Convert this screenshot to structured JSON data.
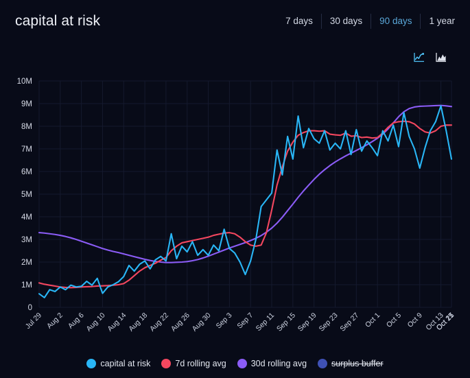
{
  "header": {
    "title": "capital at risk",
    "ranges": [
      {
        "label": "7 days",
        "active": false
      },
      {
        "label": "30 days",
        "active": false
      },
      {
        "label": "90 days",
        "active": true
      },
      {
        "label": "1 year",
        "active": false
      }
    ],
    "chart_type_buttons": [
      {
        "name": "line-chart-icon",
        "active": true
      },
      {
        "name": "area-chart-icon",
        "active": false
      }
    ]
  },
  "colors": {
    "background": "#080b18",
    "capital_at_risk": "#29b6f6",
    "rolling_7d": "#f4475f",
    "rolling_30d": "#8b5cf6",
    "surplus_buffer": "#3f51b5",
    "grid": "#151a2e",
    "accent": "#5aa7d8",
    "text": "#e8eaf2"
  },
  "legend": [
    {
      "label": "capital at risk",
      "color": "#29b6f6",
      "enabled": true
    },
    {
      "label": "7d rolling avg",
      "color": "#f4475f",
      "enabled": true
    },
    {
      "label": "30d rolling avg",
      "color": "#8b5cf6",
      "enabled": true
    },
    {
      "label": "surplus buffer",
      "color": "#3f51b5",
      "enabled": false
    }
  ],
  "chart_data": {
    "type": "line",
    "title": "capital at risk",
    "xlabel": "",
    "ylabel": "",
    "ylim": [
      0,
      10000000
    ],
    "yticks": [
      0,
      1000000,
      2000000,
      3000000,
      4000000,
      5000000,
      6000000,
      7000000,
      8000000,
      9000000,
      10000000
    ],
    "ytick_labels": [
      "0",
      "1M",
      "2M",
      "3M",
      "4M",
      "5M",
      "6M",
      "7M",
      "8M",
      "9M",
      "10M"
    ],
    "grid": true,
    "legend_position": "bottom",
    "x_tick_labels": [
      "Jul 29",
      "Aug 2",
      "Aug 6",
      "Aug 10",
      "Aug 14",
      "Aug 18",
      "Aug 22",
      "Aug 26",
      "Aug 30",
      "Sep 3",
      "Sep 7",
      "Sep 11",
      "Sep 15",
      "Sep 19",
      "Sep 23",
      "Sep 27",
      "Oct 1",
      "Oct 5",
      "Oct 9",
      "Oct 13",
      "Oct 17",
      "Oct 21",
      "Oct 25"
    ],
    "x_tick_step_days": 4,
    "x_start": "Jul 29",
    "x_end": "Oct 27",
    "series": [
      {
        "name": "capital at risk",
        "color": "#29b6f6",
        "visible": true,
        "values": [
          600000,
          430000,
          780000,
          700000,
          900000,
          780000,
          980000,
          900000,
          930000,
          1150000,
          980000,
          1280000,
          620000,
          900000,
          1000000,
          1130000,
          1360000,
          1850000,
          1600000,
          1900000,
          2050000,
          1700000,
          2100000,
          2250000,
          2050000,
          3250000,
          2150000,
          2700000,
          2450000,
          2900000,
          2300000,
          2550000,
          2300000,
          2750000,
          2500000,
          3450000,
          2600000,
          2400000,
          2000000,
          1450000,
          2050000,
          3000000,
          4450000,
          4750000,
          5050000,
          6950000,
          5850000,
          7550000,
          6550000,
          8450000,
          7050000,
          7900000,
          7450000,
          7250000,
          7800000,
          6950000,
          7250000,
          7000000,
          7800000,
          6750000,
          7850000,
          6900000,
          7350000,
          7050000,
          6700000,
          7800000,
          7350000,
          8050000,
          7100000,
          8600000,
          7550000,
          7000000,
          6150000,
          7050000,
          7800000,
          8200000,
          8900000,
          7800000,
          6550000
        ]
      },
      {
        "name": "7d rolling avg",
        "color": "#f4475f",
        "visible": true,
        "values": [
          1080000,
          1020000,
          980000,
          940000,
          900000,
          880000,
          870000,
          880000,
          900000,
          910000,
          920000,
          940000,
          950000,
          960000,
          980000,
          1000000,
          1050000,
          1200000,
          1400000,
          1600000,
          1750000,
          1850000,
          1950000,
          2080000,
          2200000,
          2500000,
          2700000,
          2850000,
          2900000,
          2950000,
          3000000,
          3050000,
          3100000,
          3180000,
          3230000,
          3280000,
          3300000,
          3250000,
          3100000,
          2900000,
          2750000,
          2700000,
          2750000,
          3300000,
          4300000,
          5400000,
          6200000,
          6900000,
          7300000,
          7600000,
          7720000,
          7800000,
          7800000,
          7780000,
          7800000,
          7650000,
          7620000,
          7600000,
          7700000,
          7560000,
          7580000,
          7500000,
          7520000,
          7480000,
          7500000,
          7700000,
          7950000,
          8150000,
          8200000,
          8220000,
          8200000,
          8100000,
          7900000,
          7750000,
          7700000,
          7800000,
          8000000,
          8050000,
          8050000
        ]
      },
      {
        "name": "30d rolling avg",
        "color": "#8b5cf6",
        "visible": true,
        "values": [
          3300000,
          3280000,
          3250000,
          3220000,
          3180000,
          3130000,
          3070000,
          3000000,
          2920000,
          2840000,
          2760000,
          2680000,
          2600000,
          2530000,
          2470000,
          2420000,
          2360000,
          2300000,
          2240000,
          2180000,
          2120000,
          2070000,
          2030000,
          2000000,
          1980000,
          1980000,
          1990000,
          2000000,
          2020000,
          2060000,
          2110000,
          2180000,
          2260000,
          2350000,
          2440000,
          2530000,
          2620000,
          2700000,
          2780000,
          2860000,
          2950000,
          3050000,
          3170000,
          3320000,
          3500000,
          3720000,
          3980000,
          4270000,
          4560000,
          4860000,
          5140000,
          5400000,
          5650000,
          5880000,
          6080000,
          6260000,
          6420000,
          6560000,
          6690000,
          6810000,
          6930000,
          7050000,
          7180000,
          7320000,
          7470000,
          7650000,
          7880000,
          8150000,
          8420000,
          8640000,
          8780000,
          8850000,
          8880000,
          8890000,
          8900000,
          8910000,
          8920000,
          8900000,
          8870000
        ]
      },
      {
        "name": "surplus buffer",
        "color": "#3f51b5",
        "visible": false,
        "values": []
      }
    ]
  }
}
